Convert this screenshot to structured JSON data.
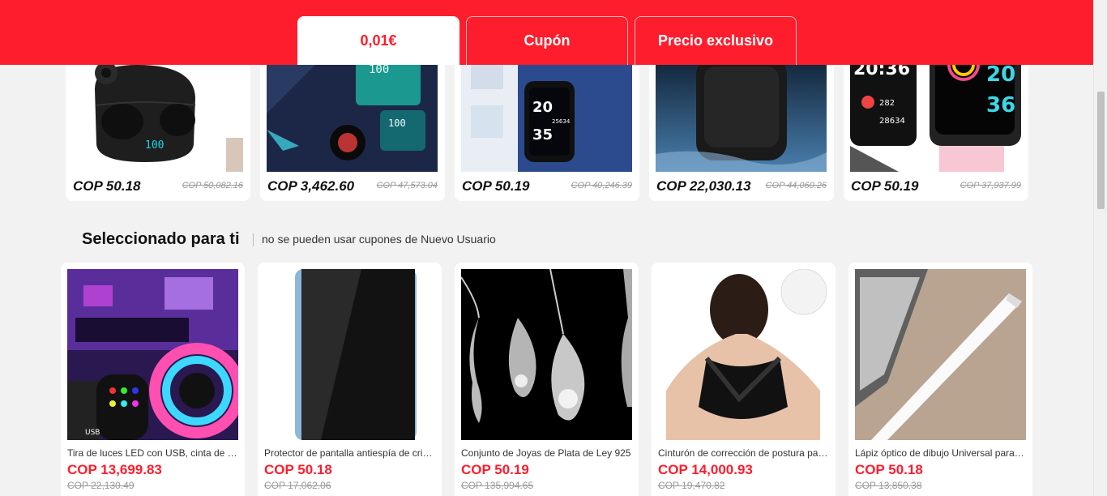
{
  "tabs": [
    {
      "label": "0,01€"
    },
    {
      "label": "Cupón"
    },
    {
      "label": "Precio exclusivo"
    }
  ],
  "top_products": [
    {
      "price": "COP 50.18",
      "old_price": "COP 50,082.16",
      "icon": "earbuds-icon"
    },
    {
      "price": "COP 3,462.60",
      "old_price": "COP 47,573.04",
      "icon": "earbuds-case-icon"
    },
    {
      "price": "COP 50.19",
      "old_price": "COP 40,246.39",
      "icon": "smartwatch-icon"
    },
    {
      "price": "COP 22,030.13",
      "old_price": "COP 44,060.26",
      "icon": "speaker-icon"
    },
    {
      "price": "COP 50.19",
      "old_price": "COP 37,937.99",
      "icon": "smartwatch-icon"
    }
  ],
  "section": {
    "title": "Seleccionado para ti",
    "subtitle": "no se pueden usar cupones de Nuevo Usuario"
  },
  "products": [
    {
      "title": "Tira de luces LED con USB, cinta de luces LED RGB",
      "price": "COP 13,699.83",
      "old_price": "COP 22,130.49",
      "icon": "led-strip-icon"
    },
    {
      "title": "Protector de pantalla antiespía de cristal templado",
      "price": "COP 50.18",
      "old_price": "COP 17,062.06",
      "icon": "screen-protector-icon"
    },
    {
      "title": "Conjunto de Joyas de Plata de Ley 925",
      "price": "COP 50.19",
      "old_price": "COP 135,994.65",
      "icon": "jewelry-icon"
    },
    {
      "title": "Cinturón de corrección de postura para espalda",
      "price": "COP 14,000.93",
      "old_price": "COP 19,470.82",
      "icon": "posture-belt-icon"
    },
    {
      "title": "Lápiz óptico de dibujo Universal para tableta",
      "price": "COP 50.18",
      "old_price": "COP 13,850.38",
      "icon": "stylus-icon"
    }
  ],
  "colors": {
    "brand_red": "#fd1d2c",
    "background": "#f2f2f2"
  }
}
